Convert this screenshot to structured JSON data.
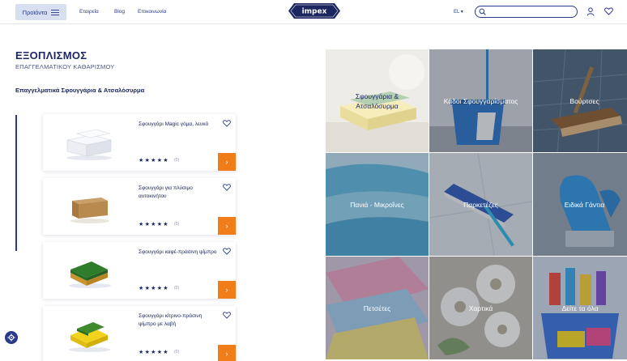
{
  "header": {
    "products_label": "Προϊόντα",
    "nav": [
      "Εταιρεία",
      "Blog",
      "Επικοινωνία"
    ],
    "logo_text": "impex",
    "lang": "EL",
    "search_placeholder": ""
  },
  "page": {
    "title": "ΕΞΟΠΛΙΣΜΟΣ",
    "subtitle": "ΕΠΑΓΓΕΛΜΑΤΙΚΟΥ ΚΑΘΑΡΙΣΜΟΥ",
    "section_heading": "Επαγγελματικά Σφουγγάρια & Ατσαλόσυρμα"
  },
  "products": [
    {
      "name": "Σφουγγάρι Magic γόμα, λευκό",
      "rating": 5,
      "rating_count": "(0)"
    },
    {
      "name": "Σφουγγάρι για πλύσιμο αυτοκινήτου",
      "rating": 5,
      "rating_count": "(0)"
    },
    {
      "name": "Σφουγγάρι καφέ-πράσινη ψίμπρο",
      "rating": 5,
      "rating_count": "(0)"
    },
    {
      "name": "Σφουγγάρι κίτρινο-πράσινη ψίμπρο με λαβή",
      "rating": 5,
      "rating_count": "(0)"
    }
  ],
  "categories": [
    {
      "label": "Σφουγγάρια & Ατσαλόσυρμα"
    },
    {
      "label": "Κάδοι Σφουγγαρίσματος"
    },
    {
      "label": "Βούρτσες"
    },
    {
      "label": "Πανιά - Μικροΐνες"
    },
    {
      "label": "Παρκετέζες"
    },
    {
      "label": "Ειδικά Γάντια"
    },
    {
      "label": "Πετσέτες"
    },
    {
      "label": "Χαρτικά"
    },
    {
      "label": "Δείτε τα όλα"
    }
  ],
  "colors": {
    "navy": "#1c2761",
    "accent": "#f07d1a",
    "nav_button_bg": "#d8dff0"
  }
}
